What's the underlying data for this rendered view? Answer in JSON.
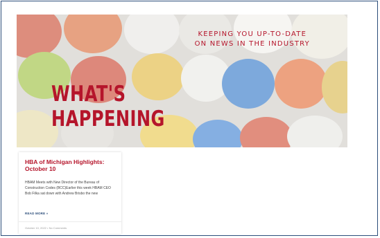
{
  "hero": {
    "tagline_line1": "KEEPING YOU UP-TO-DATE",
    "tagline_line2": "ON NEWS IN THE INDUSTRY",
    "headline_line1": "WHAT'S",
    "headline_line2": "HAPPENING",
    "image": "hard-hats-photo"
  },
  "post": {
    "title": "HBA of Michigan Highlights: October 10",
    "excerpt": "HBAM Meets with New Director of the Bureau of Construction Codes (BCC)Earlier this week HBAM CEO Bob Filka sat down with Andrew Brisbo the new",
    "read_more": "READ MORE »",
    "date": "October 10, 2022",
    "separator": "•",
    "comments": "No Comments"
  },
  "colors": {
    "accent_red": "#b5152b",
    "link_blue": "#2b4d7a",
    "frame_border": "#2b4d7a"
  }
}
